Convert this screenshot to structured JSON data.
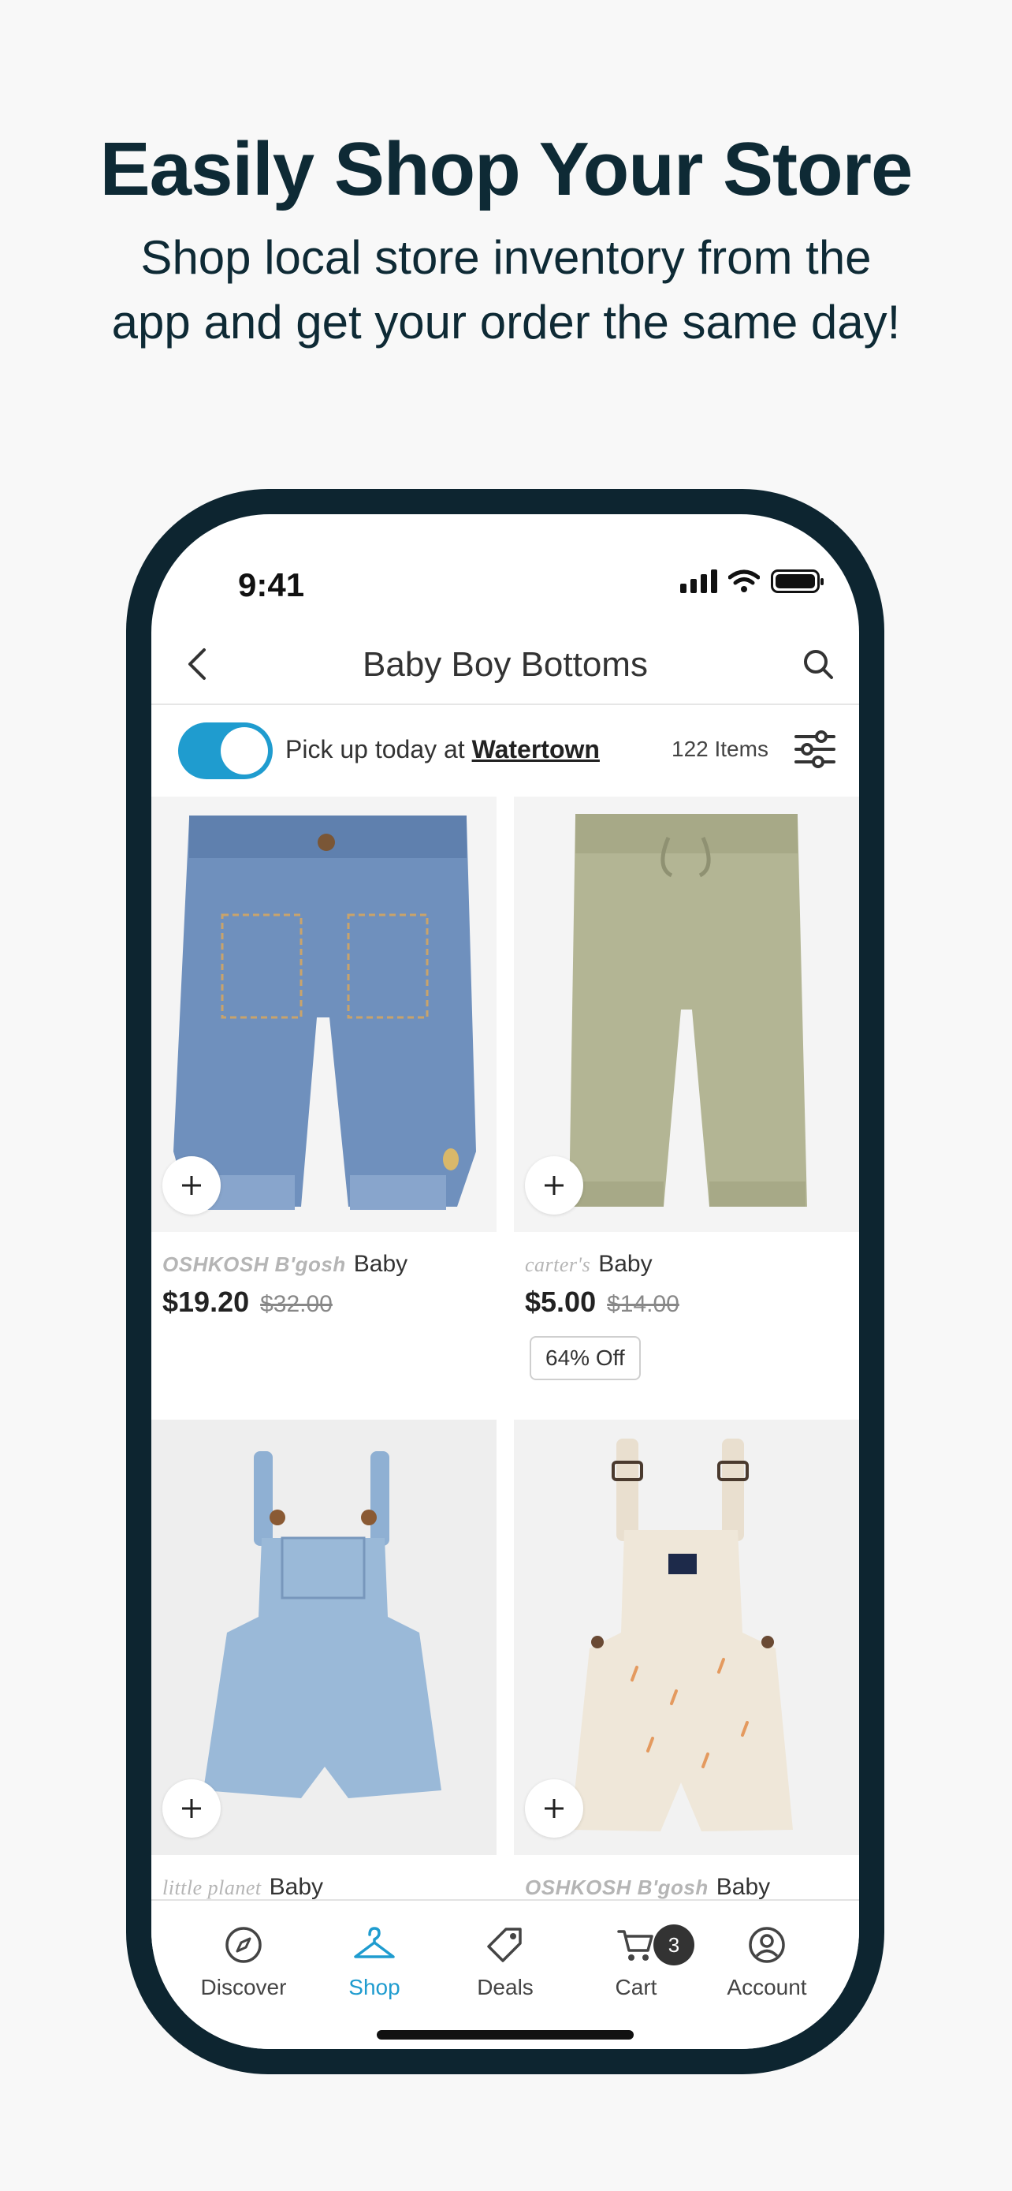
{
  "promo": {
    "headline": "Easily Shop Your Store",
    "subline_1": "Shop local store inventory from the",
    "subline_2": "app and get your order the same day!"
  },
  "status_bar": {
    "time": "9:41"
  },
  "header": {
    "title": "Baby Boy Bottoms",
    "back_icon": "chevron-left-icon",
    "search_icon": "search-icon"
  },
  "pickup": {
    "prefix": "Pick up today at ",
    "store": "Watertown",
    "toggle_on": true,
    "item_count": "122 Items",
    "filter_icon": "sliders-icon"
  },
  "products": [
    {
      "brand": "OSHKOSH B'gosh",
      "gender": "Baby",
      "price": "$19.20",
      "old_price": "$32.00",
      "discount": "",
      "image": "denim-pants",
      "color": "#6f90bd"
    },
    {
      "brand": "carter's",
      "gender": "Baby",
      "price": "$5.00",
      "old_price": "$14.00",
      "discount": "64% Off",
      "image": "olive-joggers",
      "color": "#b3b594"
    },
    {
      "brand": "little planet",
      "gender": "Baby",
      "price": "",
      "old_price": "",
      "discount": "",
      "image": "denim-shortalls",
      "color": "#9ab9d8"
    },
    {
      "brand": "OSHKOSH B'gosh",
      "gender": "Baby",
      "price": "",
      "old_price": "",
      "discount": "",
      "image": "striped-shortalls",
      "color": "#efe7d9"
    }
  ],
  "tabbar": {
    "tabs": [
      {
        "label": "Discover",
        "icon": "compass-icon",
        "active": false
      },
      {
        "label": "Shop",
        "icon": "hanger-icon",
        "active": true
      },
      {
        "label": "Deals",
        "icon": "tag-icon",
        "active": false
      },
      {
        "label": "Cart",
        "icon": "cart-icon",
        "active": false,
        "badge": "3"
      },
      {
        "label": "Account",
        "icon": "account-icon",
        "active": false
      }
    ]
  },
  "colors": {
    "accent": "#1f9ccf",
    "phone_frame": "#0d2530",
    "headline": "#0e2a35"
  }
}
